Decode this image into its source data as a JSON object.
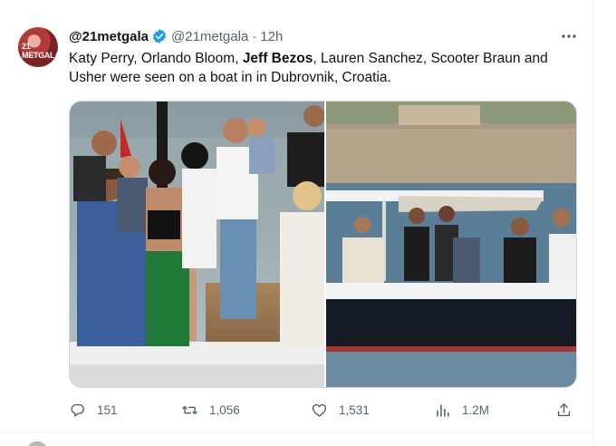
{
  "tweet": {
    "display_name": "@21metgala",
    "handle": "@21metgala",
    "separator": "·",
    "time": "12h",
    "avatar_text": "21 METGALA",
    "text_before": "Katy Perry, Orlando Bloom, ",
    "text_bold": "Jeff Bezos",
    "text_after": ", Lauren Sanchez, Scooter Braun and Usher were seen on a boat in in Dubrovnik, Croatia."
  },
  "actions": {
    "reply_count": "151",
    "retweet_count": "1,056",
    "like_count": "1,531",
    "views_count": "1.2M"
  },
  "icons": {
    "verified": "verified-badge-icon",
    "more": "more-icon",
    "reply": "reply-icon",
    "retweet": "retweet-icon",
    "like": "heart-icon",
    "views": "views-icon",
    "share": "share-icon"
  },
  "colors": {
    "text": "#0f1419",
    "secondary": "#536471",
    "verified": "#1d9bf0",
    "border": "#cfd9de"
  }
}
